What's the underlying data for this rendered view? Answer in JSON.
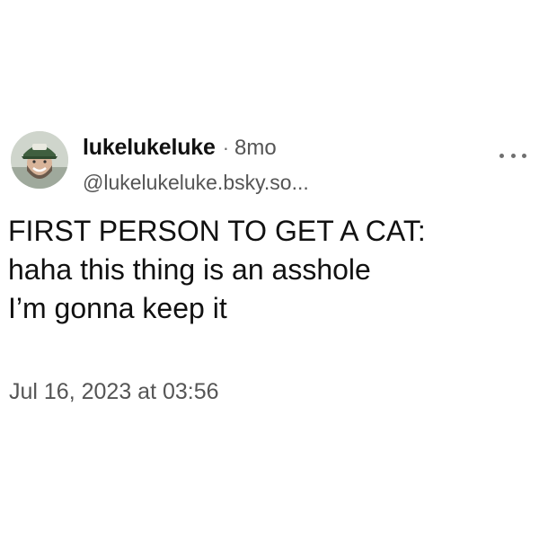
{
  "post": {
    "author": {
      "display_name": "lukelukeluke",
      "separator": "·",
      "age": "8mo",
      "handle": "@lukelukeluke.bsky.so..."
    },
    "avatar_icon": "user-avatar-photo",
    "more_icon": "more-options-dots-icon",
    "text_lines": [
      "FIRST PERSON TO GET A CAT:",
      "haha this thing is an asshole",
      "I’m gonna keep it"
    ],
    "timestamp": "Jul 16, 2023 at 03:56"
  },
  "colors": {
    "text_primary": "#111111",
    "text_secondary": "#555555",
    "background": "#ffffff"
  }
}
